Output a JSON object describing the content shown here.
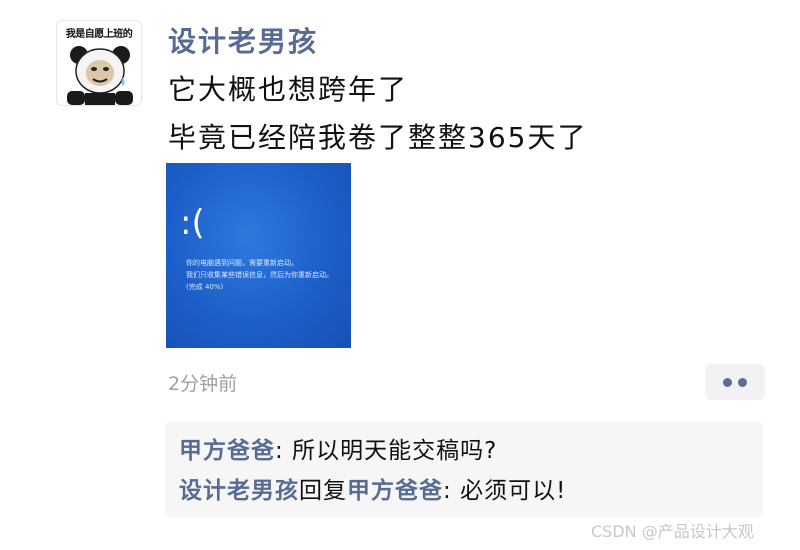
{
  "avatar": {
    "caption": "我是自愿上班的"
  },
  "author": {
    "name": "设计老男孩"
  },
  "post": {
    "lines": [
      "它大概也想跨年了",
      "毕竟已经陪我卷了整整365天了"
    ],
    "image": {
      "face": ":(",
      "lines": [
        "你的电脑遇到问题，需要重新启动。",
        "我们只收集某些错误信息，然后为你重新启动。",
        "(完成 40%)"
      ]
    },
    "timestamp": "2分钟前"
  },
  "comments": [
    {
      "author": "甲方爸爸",
      "separator": ": ",
      "text": "所以明天能交稿吗?"
    },
    {
      "author": "设计老男孩",
      "reply_word": "回复",
      "reply_to": "甲方爸爸",
      "separator": ": ",
      "text": "必须可以!"
    }
  ],
  "watermark": "CSDN @产品设计大观",
  "colors": {
    "name_blue": "#576b95",
    "bsod_blue": "#1c5fc8",
    "comment_bg": "#f6f6f6",
    "timestamp_gray": "#a0a0a0"
  },
  "icons": {
    "more": "ellipsis-icon"
  }
}
